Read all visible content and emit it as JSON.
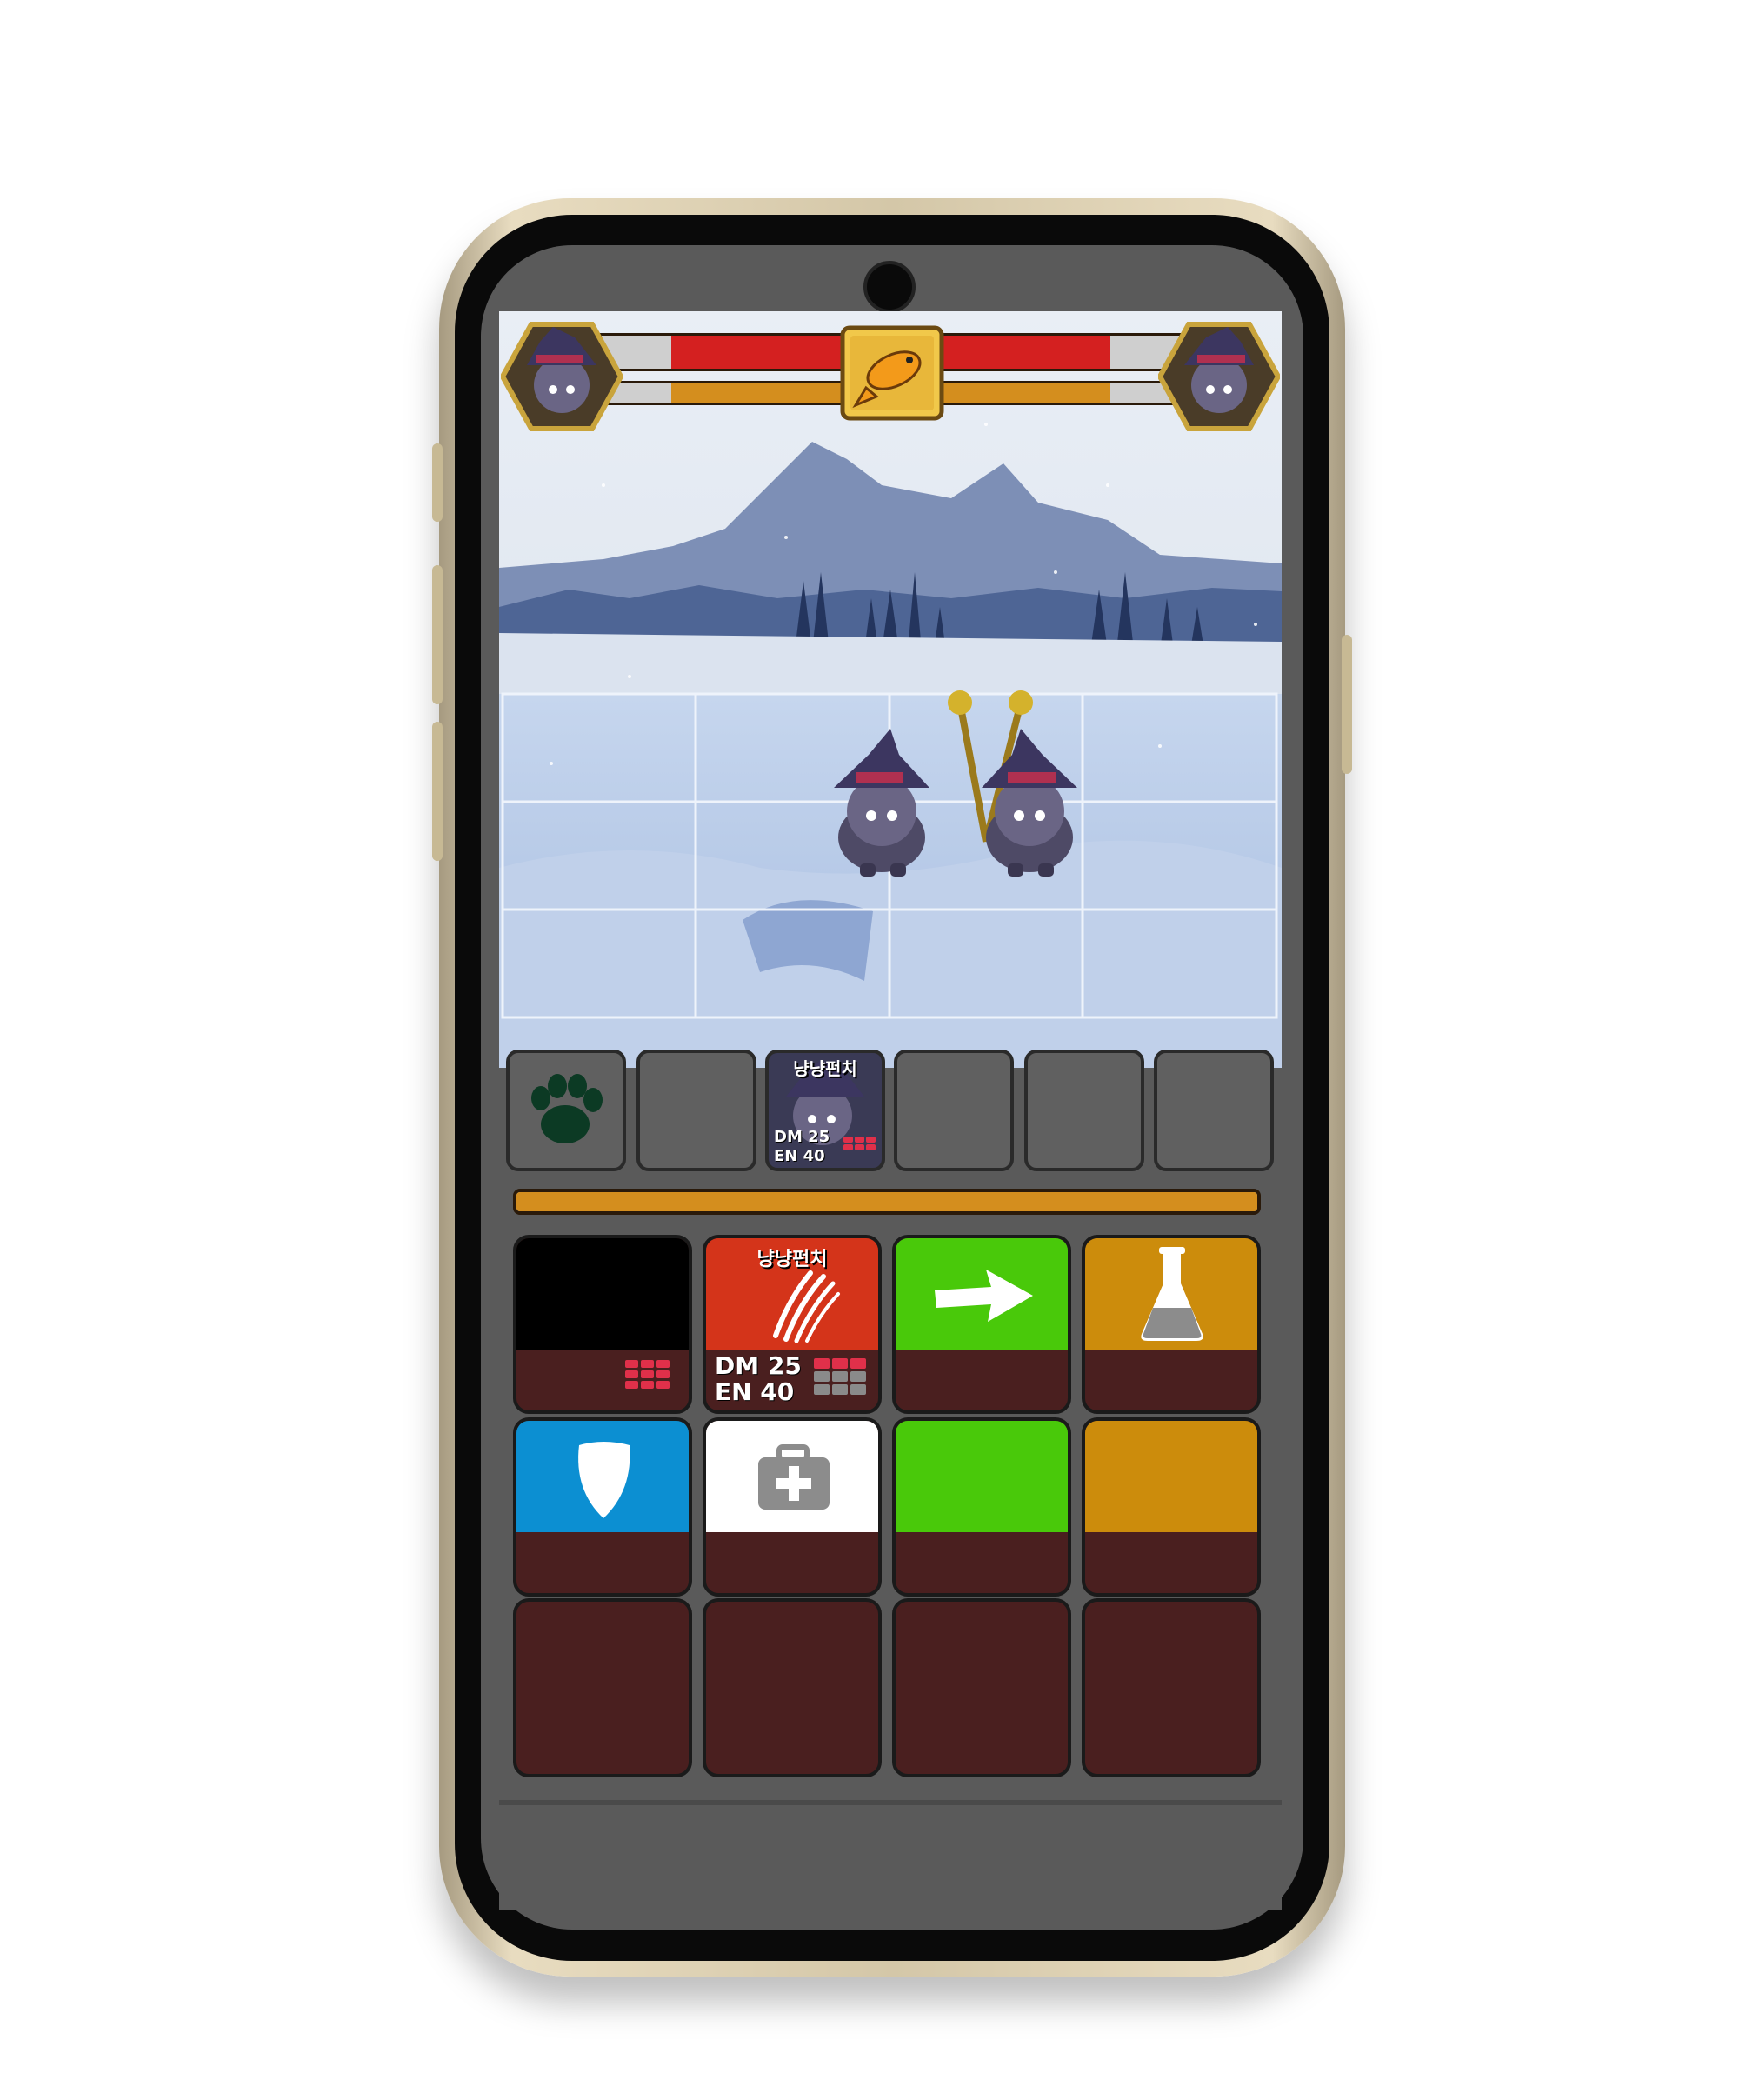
{
  "hud": {
    "player_hp": 0.74,
    "player_energy": 0.74,
    "enemy_hp": 0.74,
    "enemy_energy": 0.74,
    "center_icon": "fish-icon",
    "player_avatar": "witch-cat-portrait",
    "enemy_avatar": "witch-cat-portrait"
  },
  "battlefield": {
    "scene": "snowy-lake",
    "grid_rows": 3,
    "grid_cols": 4
  },
  "slots": [
    {
      "icon": "paw-icon",
      "label": "",
      "dm": "",
      "en": ""
    },
    {
      "icon": "",
      "label": "",
      "dm": "",
      "en": ""
    },
    {
      "icon": "witch-cat-portrait",
      "label": "냥냥펀치",
      "dm": "DM 25",
      "en": "EN 40"
    },
    {
      "icon": "",
      "label": "",
      "dm": "",
      "en": ""
    },
    {
      "icon": "",
      "label": "",
      "dm": "",
      "en": ""
    },
    {
      "icon": "",
      "label": "",
      "dm": "",
      "en": ""
    }
  ],
  "energy_bar": 1.0,
  "cards": [
    {
      "id": "black",
      "color": "#000000",
      "icon": "",
      "label": "",
      "dm": "",
      "en": ""
    },
    {
      "id": "punch",
      "color": "#d4341a",
      "icon": "claw-scratch-icon",
      "label": "냥냥펀치",
      "dm": "DM 25",
      "en": "EN 40"
    },
    {
      "id": "move",
      "color": "#49c90a",
      "icon": "arrow-right-icon",
      "label": "",
      "dm": "",
      "en": ""
    },
    {
      "id": "potion",
      "color": "#cc8c0c",
      "icon": "flask-icon",
      "label": "",
      "dm": "",
      "en": ""
    },
    {
      "id": "shield",
      "color": "#0c8fd2",
      "icon": "shield-icon",
      "label": "",
      "dm": "",
      "en": ""
    },
    {
      "id": "heal",
      "color": "#ffffff",
      "icon": "first-aid-kit-icon",
      "label": "",
      "dm": "",
      "en": ""
    },
    {
      "id": "green-empty",
      "color": "#49c90a",
      "icon": "",
      "label": "",
      "dm": "",
      "en": ""
    },
    {
      "id": "gold-empty",
      "color": "#cc8c0c",
      "icon": "",
      "label": "",
      "dm": "",
      "en": ""
    },
    {
      "id": "empty-1",
      "color": "",
      "icon": "",
      "label": "",
      "dm": "",
      "en": ""
    },
    {
      "id": "empty-2",
      "color": "",
      "icon": "",
      "label": "",
      "dm": "",
      "en": ""
    },
    {
      "id": "empty-3",
      "color": "",
      "icon": "",
      "label": "",
      "dm": "",
      "en": ""
    },
    {
      "id": "empty-4",
      "color": "",
      "icon": "",
      "label": "",
      "dm": "",
      "en": ""
    }
  ],
  "colors": {
    "hp": "#d42020",
    "energy": "#d48e1e",
    "card_base": "#4a1f1f",
    "pip_active": "#e0304a",
    "pip_inactive": "#8a8a8a"
  }
}
